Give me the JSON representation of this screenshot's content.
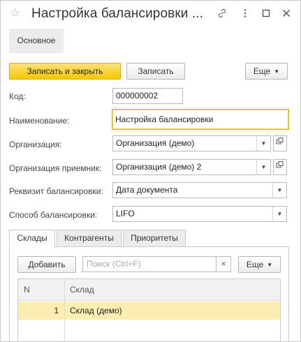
{
  "window": {
    "title": "Настройка балансировки ...",
    "icons": {
      "favorite": "star-icon",
      "link": "link-icon",
      "more": "more-vertical-icon",
      "maximize": "maximize-icon",
      "close": "close-icon"
    }
  },
  "section_tab": {
    "label": "Основное"
  },
  "toolbar": {
    "save_close_label": "Записать и закрыть",
    "save_label": "Записать",
    "more_label": "Еще"
  },
  "form": {
    "code": {
      "label": "Код:",
      "value": "000000002"
    },
    "name": {
      "label": "Наименование:",
      "value": "Настройка балансировки"
    },
    "organization": {
      "label": "Организация:",
      "value": "Организация (демо)"
    },
    "receiver_organization": {
      "label": "Организация приемник:",
      "value": "Организация (демо) 2"
    },
    "balancing_attribute": {
      "label": "Реквизит балансировки:",
      "value": "Дата документа"
    },
    "balancing_method": {
      "label": "Способ балансировки:",
      "value": "LIFO"
    }
  },
  "tabs": [
    {
      "label": "Склады",
      "active": true
    },
    {
      "label": "Контрагенты",
      "active": false
    },
    {
      "label": "Приоритеты",
      "active": false
    }
  ],
  "warehouses_panel": {
    "add_label": "Добавить",
    "search_placeholder": "Поиск (Ctrl+F)",
    "clear_symbol": "×",
    "more_label": "Еще",
    "table": {
      "columns": [
        "N",
        "Склад"
      ],
      "rows": [
        {
          "n": "1",
          "warehouse": "Склад (демо)",
          "selected": true
        }
      ]
    }
  },
  "colors": {
    "primary_button": "#f5c800",
    "focused_border": "#e2bc00",
    "selected_row": "#fbeeb0"
  }
}
